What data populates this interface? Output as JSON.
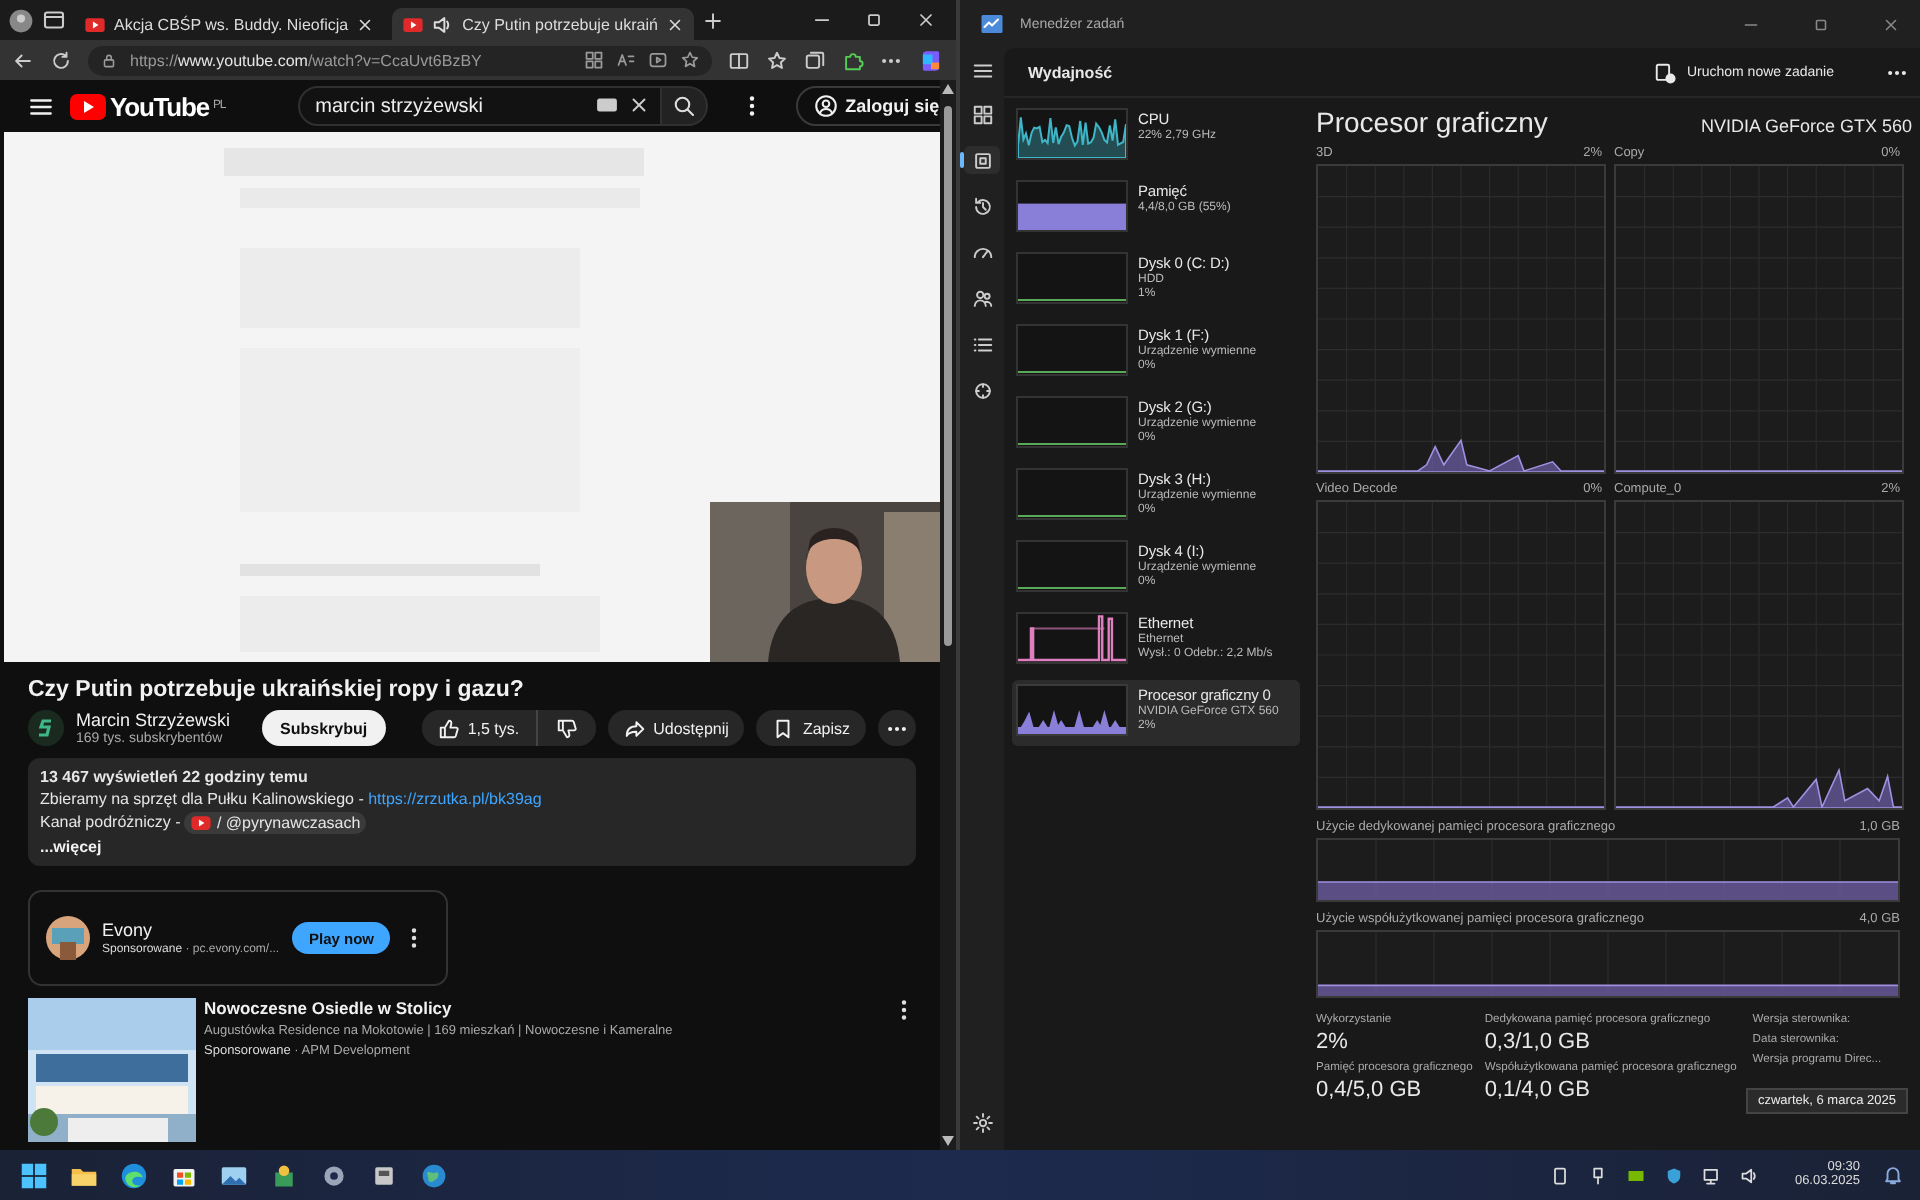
{
  "browser": {
    "tabs": [
      {
        "title": "Akcja CBŚP ws. Buddy. Nieoficja",
        "selected": false,
        "audio": false
      },
      {
        "title": "Czy Putin potrzebuje ukraiń",
        "selected": true,
        "audio": true
      }
    ],
    "url": {
      "scheme": "https://",
      "host": "www.youtube.com",
      "path": "/watch?v=CcaUvt6BzBY"
    }
  },
  "youtube": {
    "logo": "YouTube",
    "region": "PL",
    "search": {
      "value": "marcin strzyżewski"
    },
    "sign_in": "Zaloguj się",
    "title": "Czy Putin potrzebuje ukraińskiej ropy i gazu?",
    "channel": {
      "name": "Marcin Strzyżewski",
      "subscribers": "169 tys. subskrybentów",
      "subscribe": "Subskrybuj"
    },
    "likes": "1,5 tys.",
    "share": "Udostępnij",
    "save": "Zapisz",
    "description": {
      "stats": "13 467 wyświetleń  22 godziny temu",
      "lines": [
        {
          "text": "Zbieramy na sprzęt dla Pułku Kalinowskiego - ",
          "link": "https://zrzutka.pl/bk39ag",
          "kind": "link"
        },
        {
          "text": "Kanał podróżniczy - ",
          "link": "/ @pyrynawczasach",
          "kind": "channel"
        }
      ],
      "more": "...więcej"
    },
    "ads": [
      {
        "kind": "card",
        "title": "Evony",
        "source": "**Sponsorowane** · pc.evony.com/...",
        "action": "Play now"
      },
      {
        "kind": "listing",
        "title": "Nowoczesne Osiedle w Stolicy",
        "subtitle": "Augustówka Residence na Mokotowie | 169 mieszkań | Nowoczesne i Kameralne",
        "source": "**Sponsorowane** · APM Development"
      }
    ]
  },
  "task_manager": {
    "title": "Menedżer zadań",
    "page": "Wydajność",
    "new_task": "Uruchom nowe zadanie",
    "nav": [
      {
        "selected": false
      },
      {
        "selected": true
      },
      {
        "selected": false
      },
      {
        "selected": false
      },
      {
        "selected": false
      },
      {
        "selected": false
      },
      {
        "selected": false
      }
    ],
    "resources": [
      {
        "name": "CPU",
        "lines": [
          "22%  2,79 GHz"
        ],
        "kind": "spiky",
        "color": "#3fb6c8",
        "selected": false
      },
      {
        "name": "Pamięć",
        "lines": [
          "4,4/8,0 GB (55%)"
        ],
        "kind": "fill",
        "color": "#8a7fd8",
        "selected": false
      },
      {
        "name": "Dysk 0 (C: D:)",
        "lines": [
          "HDD",
          "1%"
        ],
        "kind": "flat",
        "color": "#5aa85a",
        "selected": false
      },
      {
        "name": "Dysk 1 (F:)",
        "lines": [
          "Urządzenie wymienne",
          "0%"
        ],
        "kind": "flat",
        "color": "#5aa85a",
        "selected": false
      },
      {
        "name": "Dysk 2 (G:)",
        "lines": [
          "Urządzenie wymienne",
          "0%"
        ],
        "kind": "flat",
        "color": "#5aa85a",
        "selected": false
      },
      {
        "name": "Dysk 3 (H:)",
        "lines": [
          "Urządzenie wymienne",
          "0%"
        ],
        "kind": "flat",
        "color": "#5aa85a",
        "selected": false
      },
      {
        "name": "Dysk 4 (I:)",
        "lines": [
          "Urządzenie wymienne",
          "0%"
        ],
        "kind": "flat",
        "color": "#5aa85a",
        "selected": false
      },
      {
        "name": "Ethernet",
        "lines": [
          "Ethernet",
          "Wysł.: 0 Odebr.: 2,2 Mb/s"
        ],
        "kind": "net",
        "color": "#e07fc0",
        "selected": false
      },
      {
        "name": "Procesor graficzny 0",
        "lines": [
          "NVIDIA GeForce GTX 560",
          "2%"
        ],
        "kind": "bumps",
        "color": "#8a7fd8",
        "selected": true
      }
    ],
    "detail": {
      "title": "Procesor graficzny",
      "device": "NVIDIA GeForce GTX 560",
      "graphs": [
        {
          "name": "3D",
          "value": "2%",
          "kind": "active"
        },
        {
          "name": "Copy",
          "value": "0%",
          "kind": "idle"
        },
        {
          "name": "Video Decode",
          "value": "0%",
          "kind": "idle"
        },
        {
          "name": "Compute_0",
          "value": "2%",
          "kind": "late"
        }
      ],
      "memory": [
        {
          "label": "Użycie dedykowanej pamięci procesora graficznego",
          "max": "1,0 GB"
        },
        {
          "label": "Użycie współużytkowanej pamięci procesora graficznego",
          "max": "4,0 GB"
        }
      ],
      "stats": [
        {
          "label": "Wykorzystanie",
          "value": "2%"
        },
        {
          "label": "Dedykowana pamięć procesora graficznego",
          "value": "0,3/1,0 GB"
        },
        {
          "label": "Pamięć procesora graficznego",
          "value": "0,4/5,0 GB"
        },
        {
          "label": "Współużytkowana pamięć procesora graficznego",
          "value": "0,1/4,0 GB"
        }
      ],
      "driver_info": [
        "Wersja sterownika:",
        "Data sterownika:",
        "Wersja programu Direc..."
      ]
    },
    "tooltip": "czwartek, 6 marca 2025"
  },
  "taskbar": {
    "time": "09:30",
    "date": "06.03.2025"
  }
}
